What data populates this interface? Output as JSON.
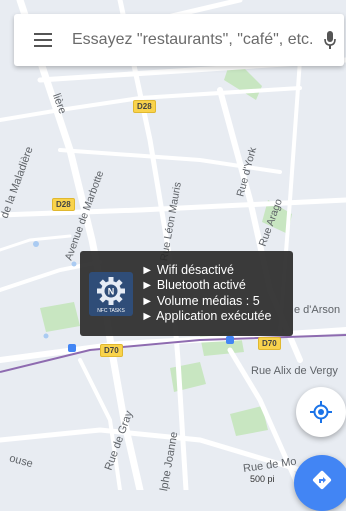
{
  "search": {
    "placeholder": "Essayez \"restaurants\", \"café\", etc."
  },
  "map": {
    "streets": [
      "Avenue de Marbotte",
      "Rue Léon Mauris",
      "Rue d'York",
      "Rue Arago",
      "de la Maladière",
      "lière",
      "Rue Alix de Vergy",
      "e d'Arson",
      "Rue de Gray",
      "lphe Joanne",
      "ouse",
      "Rue de Mo"
    ],
    "road_shields": [
      "D28",
      "D28",
      "D70",
      "D70"
    ],
    "scale": "500 pi",
    "colors": {
      "land": "#e8ecf2",
      "road": "#ffffff",
      "park": "#c8e6c1",
      "rail": "#8e6bb0",
      "water": "#aacbf2"
    }
  },
  "notification": {
    "app_icon_label": "NFC TASKS",
    "lines": [
      "► Wifi désactivé",
      "► Bluetooth activé",
      "► Volume médias : 5",
      "► Application exécutée"
    ]
  },
  "icons": {
    "menu": "hamburger-menu-icon",
    "mic": "microphone-icon",
    "location": "my-location-icon",
    "directions": "directions-icon",
    "app": "nfc-tasks-gear-icon"
  }
}
